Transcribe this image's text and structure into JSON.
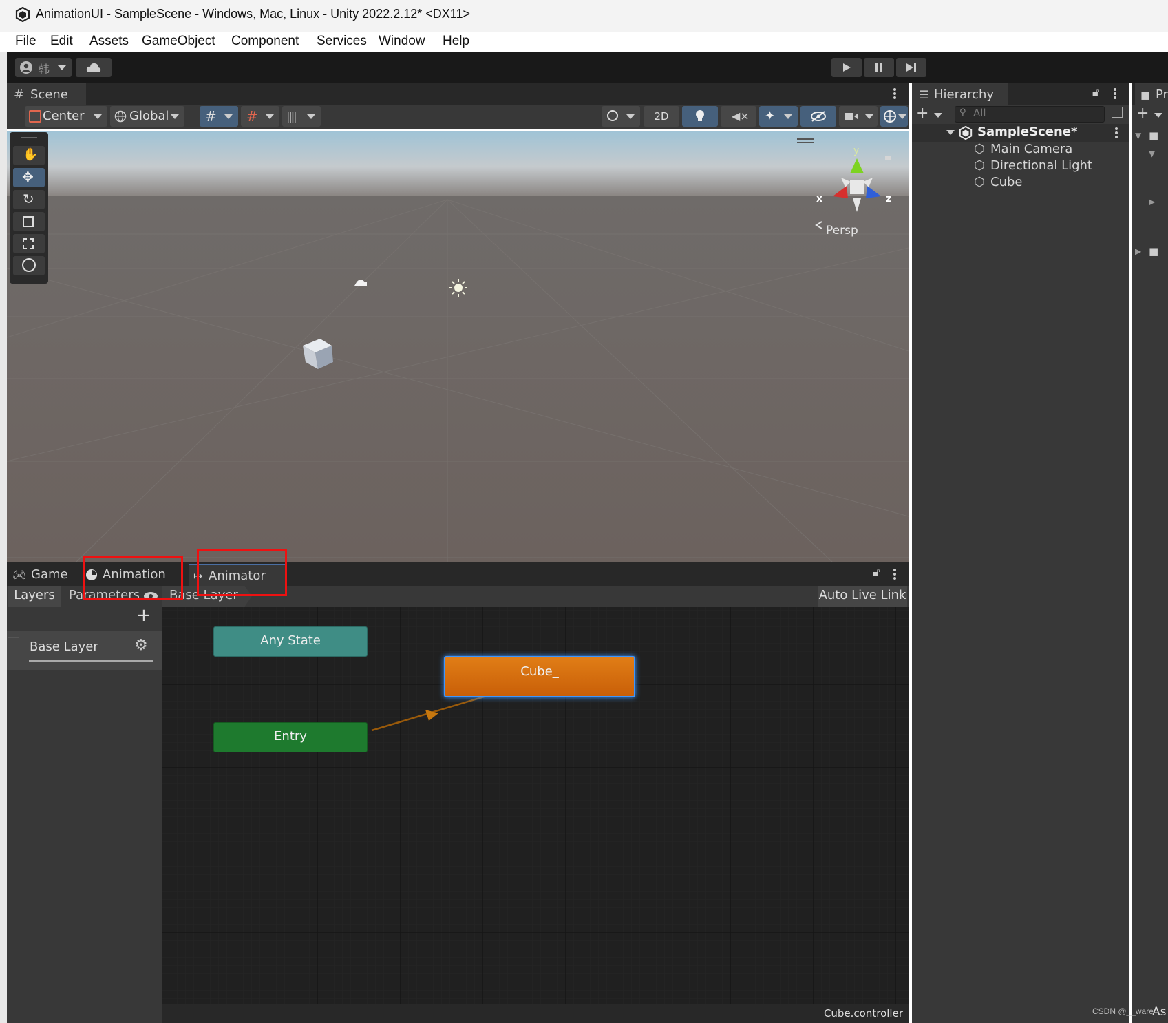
{
  "window": {
    "title": "AnimationUI - SampleScene - Windows, Mac, Linux - Unity 2022.2.12* <DX11>"
  },
  "menu": [
    "File",
    "Edit",
    "Assets",
    "GameObject",
    "Component",
    "Services",
    "Window",
    "Help"
  ],
  "toolbar": {
    "account_label": "韩",
    "play_icon": "play-icon",
    "pause_icon": "pause-icon",
    "step_icon": "step-icon"
  },
  "scene": {
    "tab_label": "Scene",
    "pivot_label": "Center",
    "space_label": "Global",
    "mode_2d": "2D",
    "gizmo": {
      "x": "x",
      "y": "y",
      "z": "z",
      "projection": "Persp"
    }
  },
  "hierarchy": {
    "tab_label": "Hierarchy",
    "search_placeholder": "All",
    "scene_name": "SampleScene*",
    "items": [
      "Main Camera",
      "Directional Light",
      "Cube"
    ]
  },
  "project": {
    "tab_label_partial": "Pr",
    "footer_partial": "As"
  },
  "bottom_tabs": {
    "game": "Game",
    "animation": "Animation",
    "animator": "Animator"
  },
  "animator": {
    "layers_tab": "Layers",
    "parameters_tab": "Parameters",
    "breadcrumb": "Base Layer",
    "auto_live_link": "Auto Live Link",
    "layer_name": "Base Layer",
    "states": {
      "any_state": "Any State",
      "cube": "Cube_",
      "entry": "Entry"
    },
    "status": "Cube.controller"
  },
  "watermark": "CSDN @__ware",
  "colors": {
    "highlight_box": "#ee1111",
    "state_orange": "#d96f0c",
    "state_teal": "#3f8d85",
    "state_green": "#1e7a2e"
  }
}
